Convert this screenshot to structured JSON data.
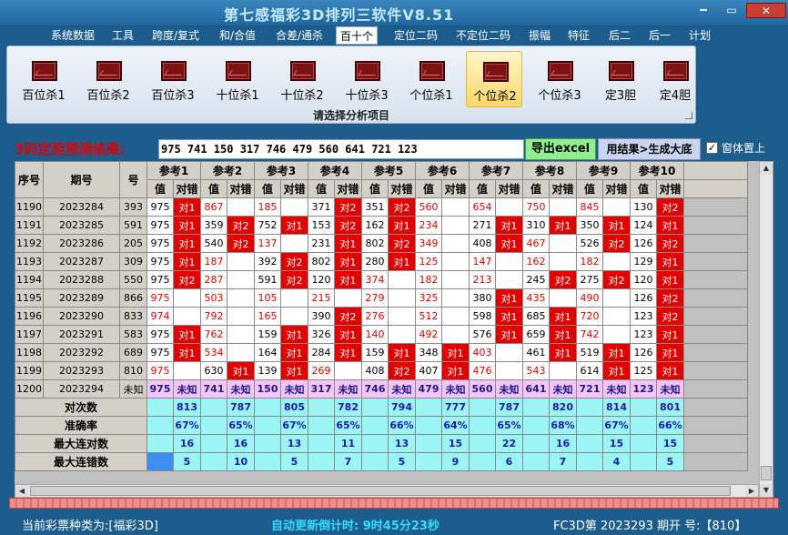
{
  "window": {
    "title": "第七感福彩3D排列三软件V8.51",
    "min": "━",
    "max": "▭",
    "close": "✕"
  },
  "menu": [
    {
      "label": "系统数据",
      "active": false
    },
    {
      "label": "工具",
      "active": false
    },
    {
      "label": "跨度/复式",
      "active": false
    },
    {
      "label": "和/合值",
      "active": false
    },
    {
      "label": "合差/通杀",
      "active": false
    },
    {
      "label": "百十个",
      "active": true
    },
    {
      "label": "定位二码",
      "active": false
    },
    {
      "label": "不定位二码",
      "active": false
    },
    {
      "label": "振幅",
      "active": false
    },
    {
      "label": "特征",
      "active": false
    },
    {
      "label": "后二",
      "active": false
    },
    {
      "label": "后一",
      "active": false
    },
    {
      "label": "计划",
      "active": false
    }
  ],
  "ribbon": {
    "buttons": [
      {
        "label": "百位杀1",
        "icon": "chart-icon"
      },
      {
        "label": "百位杀2",
        "icon": "chart-icon"
      },
      {
        "label": "百位杀3",
        "icon": "chart-icon"
      },
      {
        "label": "十位杀1",
        "icon": "chart-icon"
      },
      {
        "label": "十位杀2",
        "icon": "chart-icon"
      },
      {
        "label": "十位杀3",
        "icon": "chart-icon"
      },
      {
        "label": "个位杀1",
        "icon": "chart-icon"
      },
      {
        "label": "个位杀2",
        "icon": "chart-icon",
        "selected": true
      },
      {
        "label": "个位杀3",
        "icon": "chart-icon"
      },
      {
        "label": "定3胆",
        "icon": "chart-icon"
      },
      {
        "label": "定4胆",
        "icon": "chart-icon"
      }
    ],
    "caption": "请选择分析项目"
  },
  "prediction": {
    "label": "3码定胆预测结果:",
    "value": "975 741 150 317 746 479 560 641 721 123"
  },
  "buttons": {
    "excel": "导出excel",
    "generate": "用结果>生成大底"
  },
  "checkbox": {
    "label": "窗体置上",
    "checked": true,
    "mark": "✓"
  },
  "table": {
    "headers": {
      "seq": "序号",
      "issue": "期号",
      "num": "号",
      "value": "值",
      "result": "对错"
    },
    "refs": [
      "参考1",
      "参考2",
      "参考3",
      "参考4",
      "参考5",
      "参考6",
      "参考7",
      "参考8",
      "参考9",
      "参考10"
    ],
    "rows": [
      {
        "seq": "1190",
        "issue": "2023284",
        "num": "393",
        "c": [
          [
            "975",
            "对1"
          ],
          [
            "867",
            ""
          ],
          [
            "185",
            ""
          ],
          [
            "371",
            "对2"
          ],
          [
            "351",
            "对2"
          ],
          [
            "560",
            ""
          ],
          [
            "654",
            ""
          ],
          [
            "750",
            ""
          ],
          [
            "845",
            ""
          ],
          [
            "130",
            "对2"
          ]
        ]
      },
      {
        "seq": "1191",
        "issue": "2023285",
        "num": "591",
        "c": [
          [
            "975",
            "对1"
          ],
          [
            "359",
            "对2"
          ],
          [
            "752",
            "对1"
          ],
          [
            "153",
            "对2"
          ],
          [
            "162",
            "对1"
          ],
          [
            "234",
            ""
          ],
          [
            "271",
            "对1"
          ],
          [
            "310",
            "对1"
          ],
          [
            "350",
            "对1"
          ],
          [
            "124",
            "对1"
          ]
        ]
      },
      {
        "seq": "1192",
        "issue": "2023286",
        "num": "205",
        "c": [
          [
            "975",
            "对1"
          ],
          [
            "540",
            "对2"
          ],
          [
            "137",
            ""
          ],
          [
            "231",
            "对1"
          ],
          [
            "802",
            "对2"
          ],
          [
            "349",
            ""
          ],
          [
            "408",
            "对1"
          ],
          [
            "467",
            ""
          ],
          [
            "526",
            "对2"
          ],
          [
            "126",
            "对2"
          ]
        ]
      },
      {
        "seq": "1193",
        "issue": "2023287",
        "num": "309",
        "c": [
          [
            "975",
            "对1"
          ],
          [
            "187",
            ""
          ],
          [
            "392",
            "对2"
          ],
          [
            "802",
            "对1"
          ],
          [
            "280",
            "对1"
          ],
          [
            "125",
            ""
          ],
          [
            "147",
            ""
          ],
          [
            "162",
            ""
          ],
          [
            "182",
            ""
          ],
          [
            "129",
            "对1"
          ]
        ]
      },
      {
        "seq": "1194",
        "issue": "2023288",
        "num": "550",
        "c": [
          [
            "975",
            "对2"
          ],
          [
            "287",
            ""
          ],
          [
            "591",
            "对2"
          ],
          [
            "120",
            "对1"
          ],
          [
            "374",
            ""
          ],
          [
            "182",
            ""
          ],
          [
            "213",
            ""
          ],
          [
            "245",
            "对2"
          ],
          [
            "275",
            "对2"
          ],
          [
            "120",
            "对1"
          ]
        ]
      },
      {
        "seq": "1195",
        "issue": "2023289",
        "num": "866",
        "c": [
          [
            "975",
            ""
          ],
          [
            "503",
            ""
          ],
          [
            "105",
            ""
          ],
          [
            "215",
            ""
          ],
          [
            "279",
            ""
          ],
          [
            "325",
            ""
          ],
          [
            "380",
            "对1"
          ],
          [
            "435",
            ""
          ],
          [
            "490",
            ""
          ],
          [
            "126",
            "对2"
          ]
        ]
      },
      {
        "seq": "1196",
        "issue": "2023290",
        "num": "833",
        "c": [
          [
            "974",
            ""
          ],
          [
            "792",
            ""
          ],
          [
            "165",
            ""
          ],
          [
            "390",
            "对2"
          ],
          [
            "276",
            ""
          ],
          [
            "512",
            ""
          ],
          [
            "598",
            "对1"
          ],
          [
            "685",
            "对1"
          ],
          [
            "720",
            ""
          ],
          [
            "123",
            "对2"
          ]
        ]
      },
      {
        "seq": "1197",
        "issue": "2023291",
        "num": "583",
        "c": [
          [
            "975",
            "对1"
          ],
          [
            "762",
            ""
          ],
          [
            "159",
            "对1"
          ],
          [
            "326",
            "对1"
          ],
          [
            "140",
            ""
          ],
          [
            "492",
            ""
          ],
          [
            "576",
            "对1"
          ],
          [
            "659",
            "对1"
          ],
          [
            "742",
            ""
          ],
          [
            "123",
            "对1"
          ]
        ]
      },
      {
        "seq": "1198",
        "issue": "2023292",
        "num": "689",
        "c": [
          [
            "975",
            "对1"
          ],
          [
            "534",
            ""
          ],
          [
            "164",
            "对1"
          ],
          [
            "284",
            "对1"
          ],
          [
            "159",
            "对1"
          ],
          [
            "348",
            "对1"
          ],
          [
            "403",
            ""
          ],
          [
            "461",
            "对1"
          ],
          [
            "519",
            "对1"
          ],
          [
            "126",
            "对1"
          ]
        ]
      },
      {
        "seq": "1199",
        "issue": "2023293",
        "num": "810",
        "c": [
          [
            "975",
            ""
          ],
          [
            "630",
            "对1"
          ],
          [
            "139",
            "对1"
          ],
          [
            "269",
            ""
          ],
          [
            "408",
            "对2"
          ],
          [
            "407",
            "对1"
          ],
          [
            "476",
            ""
          ],
          [
            "543",
            ""
          ],
          [
            "614",
            "对1"
          ],
          [
            "125",
            "对1"
          ]
        ]
      }
    ],
    "current": {
      "seq": "1200",
      "issue": "2023294",
      "num": "未知",
      "values": [
        "975",
        "741",
        "150",
        "317",
        "746",
        "479",
        "560",
        "641",
        "721",
        "123"
      ],
      "pending": "未知"
    },
    "stats": [
      {
        "label": "对次数",
        "values": [
          "813",
          "787",
          "805",
          "782",
          "794",
          "777",
          "787",
          "820",
          "814",
          "801"
        ]
      },
      {
        "label": "准确率",
        "values": [
          "67%",
          "65%",
          "67%",
          "65%",
          "66%",
          "64%",
          "65%",
          "68%",
          "67%",
          "66%"
        ]
      },
      {
        "label": "最大连对数",
        "values": [
          "16",
          "16",
          "13",
          "11",
          "13",
          "15",
          "22",
          "16",
          "15",
          "15"
        ]
      },
      {
        "label": "最大连错数",
        "values": [
          "5",
          "10",
          "5",
          "7",
          "5",
          "9",
          "6",
          "7",
          "4",
          "5"
        ]
      }
    ]
  },
  "status": {
    "lottery": "当前彩票种类为:[福彩3D]",
    "update": "自动更新倒计时:  9时45分23秒",
    "issue": "FC3D第 2023293 期开  号:【810】"
  },
  "colors": {
    "hit": "#e00000",
    "prediction_row": "#f7c4f7",
    "stats": "#9cf5f5",
    "accent": "#1c5d8e"
  }
}
